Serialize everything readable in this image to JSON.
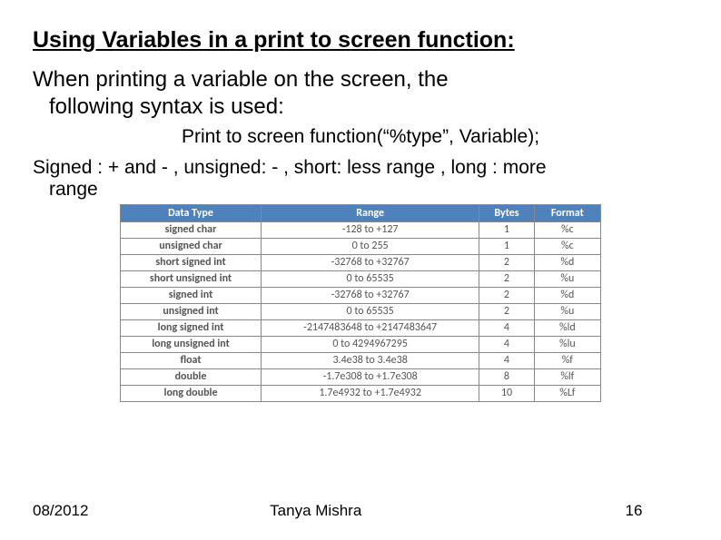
{
  "title": "Using Variables in a print to screen function:",
  "intro_line1": "When printing a variable on the screen, the",
  "intro_line2": "following syntax is used:",
  "syntax_line": "Print to screen function(“%type”, Variable);",
  "note_line1": "Signed : + and - , unsigned: - , short: less range , long : more",
  "note_line2": "range",
  "table": {
    "headers": [
      "Data Type",
      "Range",
      "Bytes",
      "Format"
    ],
    "rows": [
      {
        "name": "signed char",
        "range": "-128 to +127",
        "bytes": "1",
        "format": "%c"
      },
      {
        "name": "unsigned char",
        "range": "0 to 255",
        "bytes": "1",
        "format": "%c"
      },
      {
        "name": "short signed int",
        "range": "-32768 to +32767",
        "bytes": "2",
        "format": "%d"
      },
      {
        "name": "short  unsigned int",
        "range": "0 to 65535",
        "bytes": "2",
        "format": "%u"
      },
      {
        "name": "signed int",
        "range": "-32768 to +32767",
        "bytes": "2",
        "format": "%d"
      },
      {
        "name": "unsigned int",
        "range": "0 to 65535",
        "bytes": "2",
        "format": "%u"
      },
      {
        "name": "long signed int",
        "range": "-2147483648 to +2147483647",
        "bytes": "4",
        "format": "%ld"
      },
      {
        "name": "long unsigned int",
        "range": "0 to 4294967295",
        "bytes": "4",
        "format": "%lu"
      },
      {
        "name": "float",
        "range": "3.4e38 to 3.4e38",
        "bytes": "4",
        "format": "%f"
      },
      {
        "name": "double",
        "range": "-1.7e308 to +1.7e308",
        "bytes": "8",
        "format": "%lf"
      },
      {
        "name": "long double",
        "range": "1.7e4932 to +1.7e4932",
        "bytes": "10",
        "format": "%Lf"
      }
    ]
  },
  "footer": {
    "date": "08/2012",
    "author": "Tanya Mishra",
    "page": "16"
  }
}
